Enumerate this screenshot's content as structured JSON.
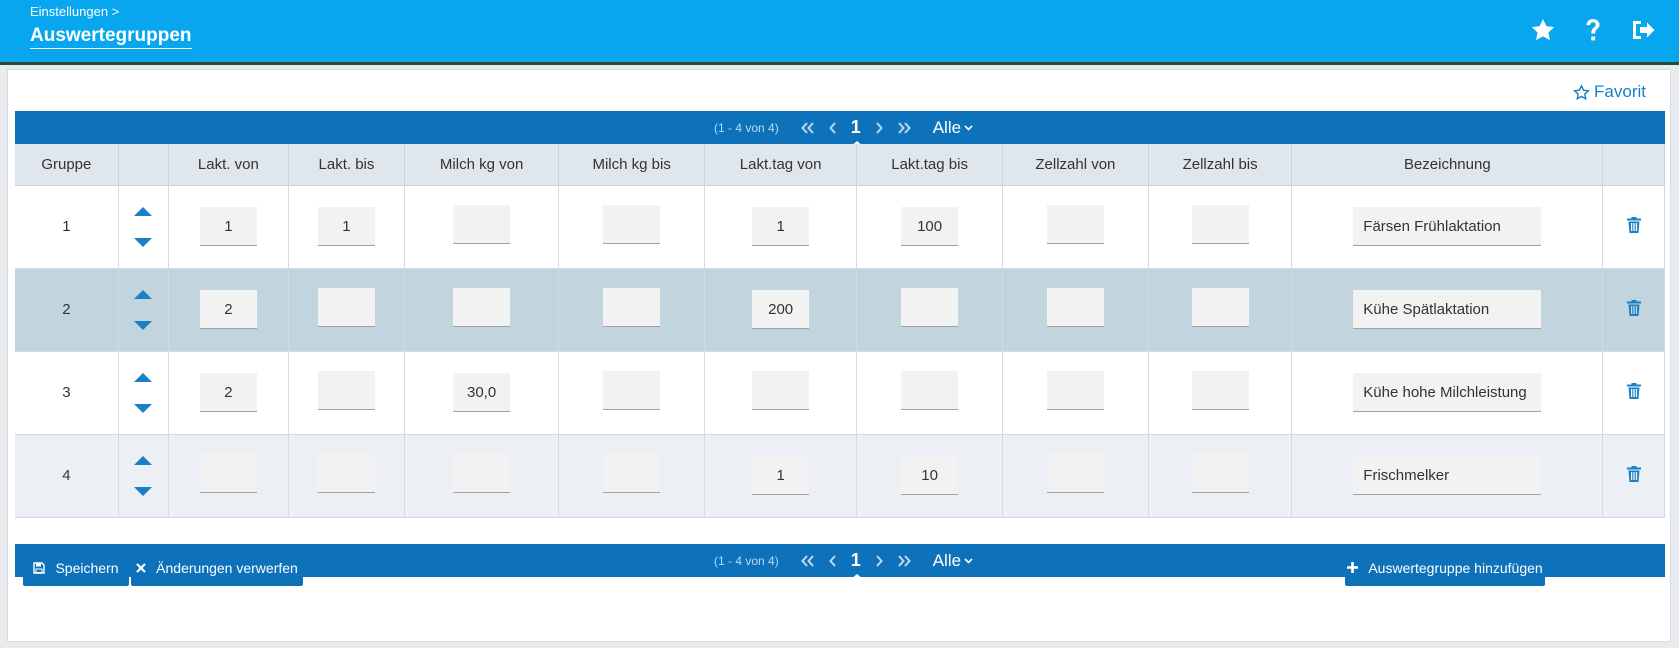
{
  "header": {
    "breadcrumb": "Einstellungen >",
    "title": "Auswertegruppen",
    "icons": [
      "star-icon",
      "help-icon",
      "logout-icon"
    ]
  },
  "favorite": {
    "label": "Favorit"
  },
  "pager": {
    "range": "(1 - 4 von 4)",
    "current_page": "1",
    "page_size": "Alle"
  },
  "table": {
    "headers": [
      "Gruppe",
      "",
      "Lakt. von",
      "Lakt. bis",
      "Milch kg von",
      "Milch kg bis",
      "Lakt.tag von",
      "Lakt.tag bis",
      "Zellzahl von",
      "Zellzahl bis",
      "Bezeichnung",
      ""
    ],
    "rows": [
      {
        "gruppe": "1",
        "lakt_von": "1",
        "lakt_bis": "1",
        "milch_von": "",
        "milch_bis": "",
        "lakttag_von": "1",
        "lakttag_bis": "100",
        "zell_von": "",
        "zell_bis": "",
        "bezeichnung": "Färsen Frühlaktation"
      },
      {
        "gruppe": "2",
        "lakt_von": "2",
        "lakt_bis": "",
        "milch_von": "",
        "milch_bis": "",
        "lakttag_von": "200",
        "lakttag_bis": "",
        "zell_von": "",
        "zell_bis": "",
        "bezeichnung": "Kühe Spätlaktation"
      },
      {
        "gruppe": "3",
        "lakt_von": "2",
        "lakt_bis": "",
        "milch_von": "30,0",
        "milch_bis": "",
        "lakttag_von": "",
        "lakttag_bis": "",
        "zell_von": "",
        "zell_bis": "",
        "bezeichnung": "Kühe hohe Milchleistung"
      },
      {
        "gruppe": "4",
        "lakt_von": "",
        "lakt_bis": "",
        "milch_von": "",
        "milch_bis": "",
        "lakttag_von": "1",
        "lakttag_bis": "10",
        "zell_von": "",
        "zell_bis": "",
        "bezeichnung": "Frischmelker"
      }
    ]
  },
  "buttons": {
    "save": "Speichern",
    "discard": "Änderungen verwerfen",
    "add": "Auswertegruppe hinzufügen"
  },
  "colors": {
    "header": "#08a6ee",
    "pager": "#0e72bb",
    "accent": "#1a80c4",
    "row_highlight": "#c2d4de"
  }
}
